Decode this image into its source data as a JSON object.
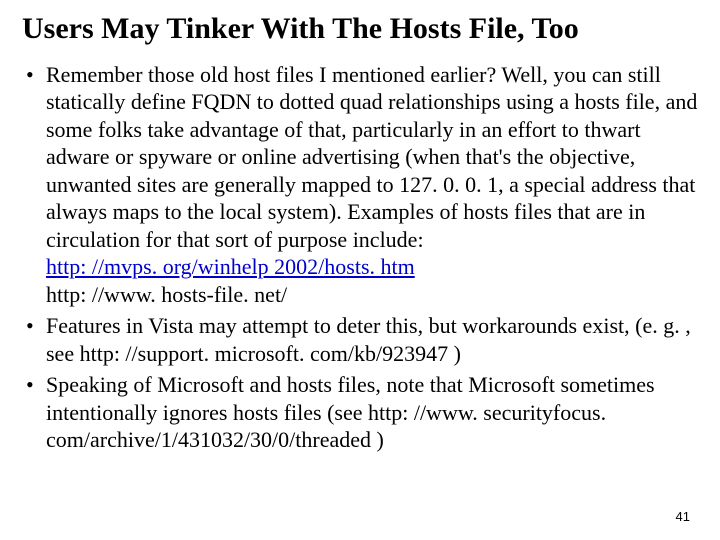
{
  "title": "Users May Tinker With The Hosts File, Too",
  "bullets": [
    {
      "pre": "Remember those old host files I mentioned earlier? Well, you can still statically define FQDN to dotted quad relationships using a hosts file, and some folks take advantage of that, particularly in an effort to thwart adware or spyware or online advertising (when that's the objective, unwanted sites are generally mapped to 127. 0. 0. 1, a special address that always maps to the local system). Examples of hosts files that are in circulation for that sort of purpose include:",
      "link1": "http: //mvps. org/winhelp 2002/hosts. htm",
      "line2": "http: //www. hosts-file. net/"
    },
    {
      "text": "Features in Vista may attempt to deter this, but workarounds exist, (e. g. , see http: //support. microsoft. com/kb/923947 )"
    },
    {
      "text": "Speaking of Microsoft and hosts files, note that Microsoft sometimes intentionally ignores hosts files (see http: //www. securityfocus. com/archive/1/431032/30/0/threaded )"
    }
  ],
  "pagenum": "41"
}
